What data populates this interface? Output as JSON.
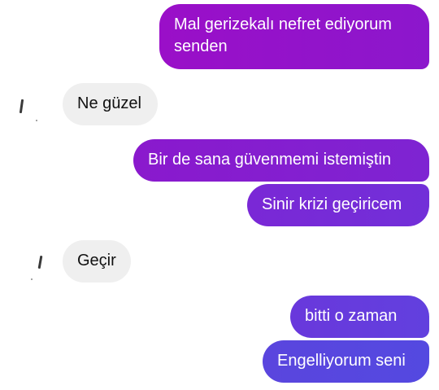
{
  "conversation": {
    "messages": [
      {
        "sender": "me",
        "text": "Mal gerizekalı nefret ediyorum senden",
        "color": "#a312c9"
      },
      {
        "sender": "them",
        "text": "Ne güzel"
      },
      {
        "sender": "me",
        "text": "Bir de sana güvenmemi istemiştin",
        "color": "#8a23cf"
      },
      {
        "sender": "me",
        "text": "Sinir krizi geçiricem",
        "color": "#7d2bd6"
      },
      {
        "sender": "them",
        "text": "Geçir"
      },
      {
        "sender": "me",
        "text": "bitti o zaman",
        "color": "#6a3bdc"
      },
      {
        "sender": "me",
        "text": "Engelliyorum seni",
        "color": "#5a46de"
      }
    ]
  },
  "colors": {
    "outgoing_gradient_top": "#b00ec3",
    "outgoing_gradient_bottom": "#5548e0",
    "incoming_bubble": "#efefef",
    "incoming_text": "#111111"
  },
  "icons": {
    "sender_avatar": "avatar-icon"
  }
}
